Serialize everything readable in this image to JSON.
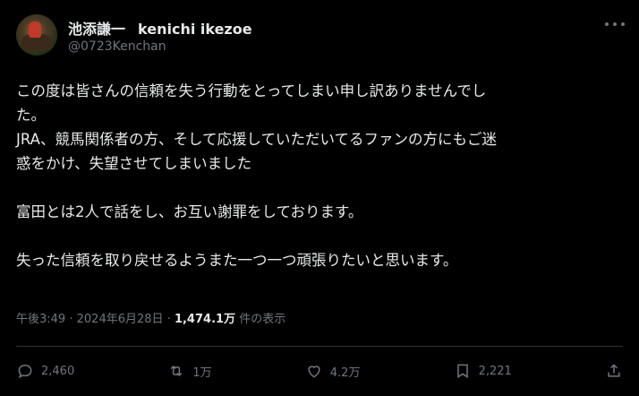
{
  "author": {
    "display_name": "池添謙一",
    "name_roman": "kenichi ikezoe",
    "handle": "@0723Kenchan"
  },
  "tweet": {
    "line1": "この度は皆さんの信頼を失う行動をとってしまい申し訳ありませんでし",
    "line2": "た。",
    "line3": "JRA、競馬関係者の方、そして応援していただいてるファンの方にもご迷",
    "line4": "惑をかけ、失望させてしまいました",
    "line5": "富田とは2人で話をし、お互い謝罪をしております。",
    "line6": "失った信頼を取り戻せるようまた一つ一つ頑張りたいと思います。"
  },
  "meta": {
    "time": "午後3:49",
    "separator": "·",
    "date": "2024年6月28日",
    "views_count": "1,474.1万",
    "views_label": "件の表示"
  },
  "actions": {
    "reply_count": "2,460",
    "retweet_count": "1万",
    "like_count": "4.2万",
    "bookmark_count": "2,221"
  },
  "icons": {
    "more": "more-dots-icon",
    "reply": "reply-icon",
    "retweet": "retweet-icon",
    "like": "heart-icon",
    "bookmark": "bookmark-icon",
    "share": "share-icon"
  },
  "colors": {
    "background": "#000000",
    "text": "#e7e9ea",
    "secondary": "#71767b",
    "divider": "#2f3336"
  }
}
